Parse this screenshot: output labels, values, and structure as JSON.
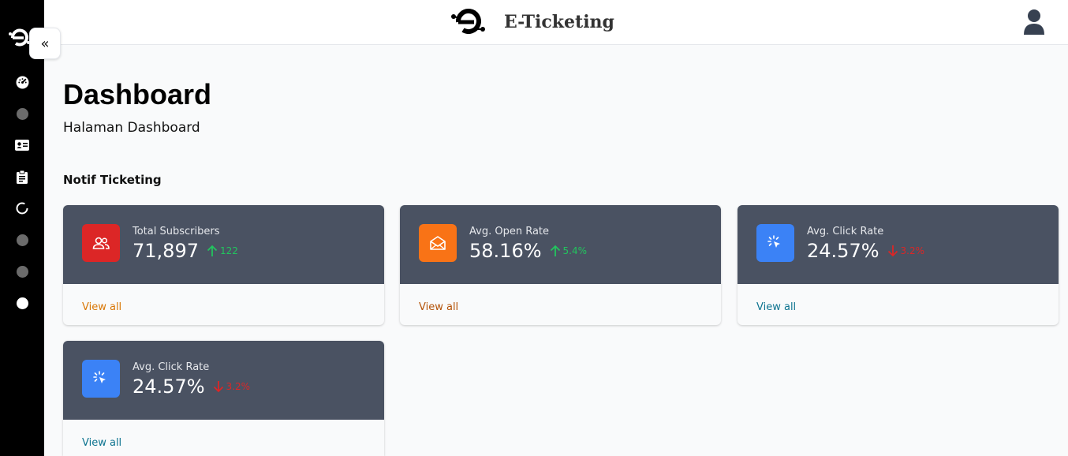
{
  "header": {
    "brand_title": "E-Ticketing"
  },
  "sidebar": {
    "items": [
      {
        "icon": "dashboard-icon"
      },
      {
        "icon": "circle-icon"
      },
      {
        "icon": "id-card-icon"
      },
      {
        "icon": "clipboard-icon"
      },
      {
        "icon": "loading-circle-icon"
      },
      {
        "icon": "circle-icon"
      },
      {
        "icon": "circle-icon"
      },
      {
        "icon": "circle-icon"
      }
    ]
  },
  "page": {
    "title": "Dashboard",
    "subtitle": "Halaman Dashboard",
    "section_label": "Notif Ticketing"
  },
  "cards": [
    {
      "label": "Total Subscribers",
      "value": "71,897",
      "trend_value": "122",
      "trend": "up",
      "icon": "users-icon",
      "icon_color": "#dc2626",
      "link_text": "View all",
      "link_color": "#d97706"
    },
    {
      "label": "Avg. Open Rate",
      "value": "58.16%",
      "trend_value": "5.4%",
      "trend": "up",
      "icon": "envelope-open-icon",
      "icon_color": "#f97316",
      "link_text": "View all",
      "link_color": "#b45309"
    },
    {
      "label": "Avg. Click Rate",
      "value": "24.57%",
      "trend_value": "3.2%",
      "trend": "down",
      "icon": "cursor-click-icon",
      "icon_color": "#3b82f6",
      "link_text": "View all",
      "link_color": "#0e7490"
    },
    {
      "label": "Avg. Click Rate",
      "value": "24.57%",
      "trend_value": "3.2%",
      "trend": "down",
      "icon": "cursor-click-icon",
      "icon_color": "#3b82f6",
      "link_text": "View all",
      "link_color": "#0e7490"
    }
  ],
  "colors": {
    "sidebar_bg": "#000000",
    "card_header_bg": "#4a5262",
    "trend_up": "#22c55e",
    "trend_down": "#dc2626"
  }
}
